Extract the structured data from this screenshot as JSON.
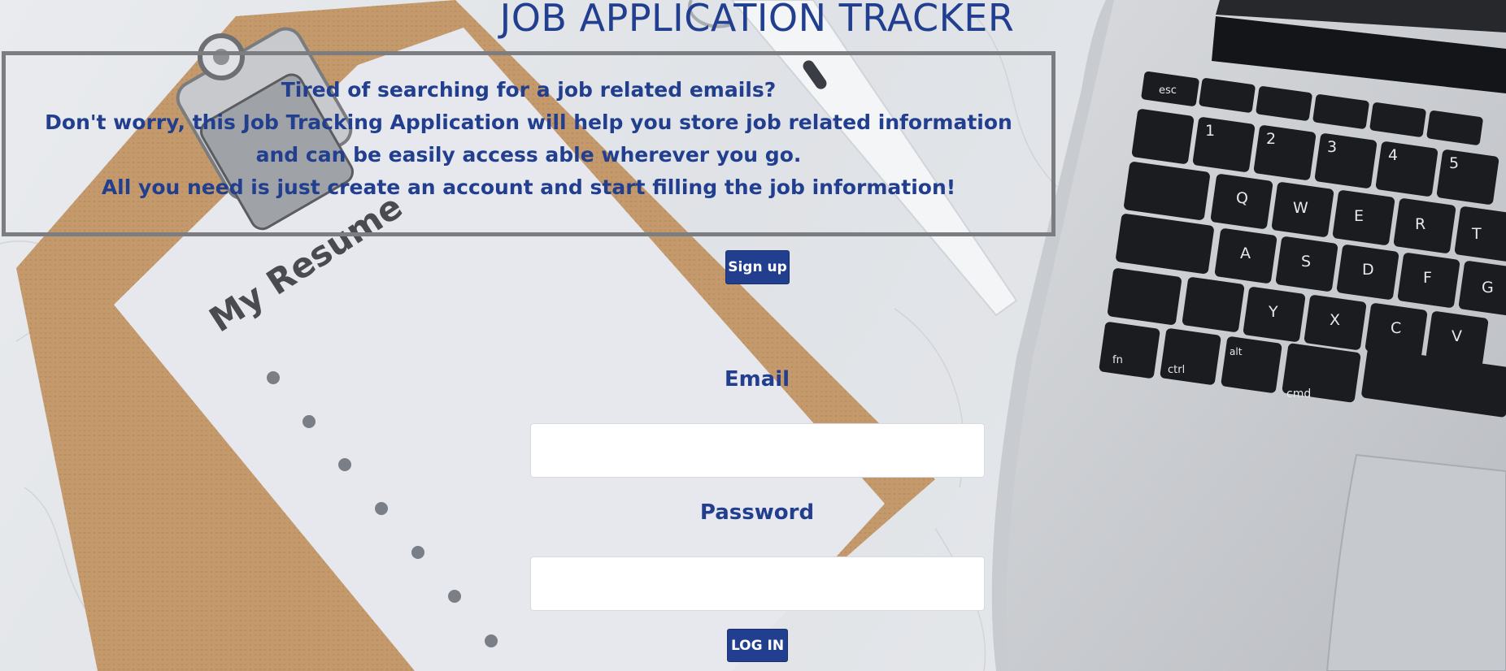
{
  "page": {
    "title": "JOB APPLICATION TRACKER"
  },
  "intro": {
    "line1": "Tired of searching for a job related emails?",
    "line2": "Don't worry, this Job Tracking Application will help you store job related information and can be easily access able wherever you go.",
    "line3": "All you need is just create an account and start filling the job information!"
  },
  "background": {
    "resume_text": "My Resume",
    "keys": {
      "esc": "esc",
      "fn": "fn",
      "ctrl": "ctrl",
      "alt": "alt",
      "cmd": "cmd",
      "q": "Q",
      "w": "W",
      "e": "E",
      "r": "R",
      "t": "T",
      "a": "A",
      "s": "S",
      "d": "D",
      "f": "F",
      "g": "G",
      "y": "Y",
      "x": "X",
      "c": "C",
      "v": "V",
      "n1": "1",
      "n2": "2",
      "n3": "3",
      "n4": "4",
      "n5": "5"
    }
  },
  "signup": {
    "label": "Sign up"
  },
  "login": {
    "email_label": "Email",
    "email_value": "",
    "password_label": "Password",
    "password_value": "",
    "submit_label": "LOG IN"
  },
  "colors": {
    "accent": "#223f8f",
    "box_border": "#7b7d80"
  }
}
